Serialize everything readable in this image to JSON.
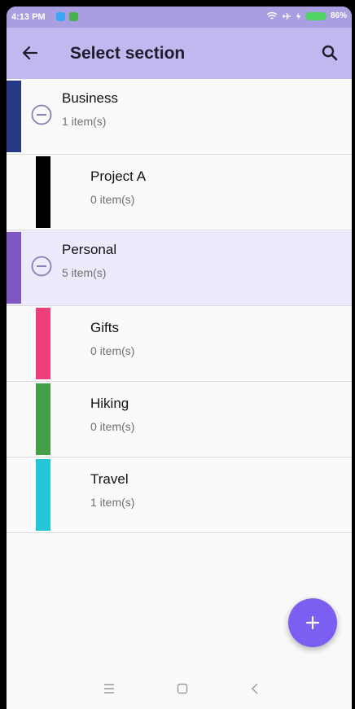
{
  "status_bar": {
    "time": "4:13 PM",
    "battery": "86%"
  },
  "app_bar": {
    "title": "Select section",
    "back_icon": "arrow-left-icon",
    "search_icon": "search-icon"
  },
  "sections": [
    {
      "name": "Business",
      "count": "1 item(s)",
      "level": "parent",
      "color": "#283a86",
      "expanded": true
    },
    {
      "name": "Project A",
      "count": "0 item(s)",
      "level": "child",
      "color": "#000000"
    },
    {
      "name": "Personal",
      "count": "5 item(s)",
      "level": "parent",
      "color": "#7e57c2",
      "expanded": true,
      "selected": true
    },
    {
      "name": "Gifts",
      "count": "0 item(s)",
      "level": "child",
      "color": "#ec407a"
    },
    {
      "name": "Hiking",
      "count": "0 item(s)",
      "level": "child",
      "color": "#43a047"
    },
    {
      "name": "Travel",
      "count": "1 item(s)",
      "level": "child",
      "color": "#26c6da"
    }
  ],
  "fab": {
    "icon": "plus-icon",
    "color": "#7c5ff0"
  },
  "colors": {
    "app_bar": "#c0b9f0",
    "status_bar": "#a99fe0",
    "selected_row": "#efe9fd"
  }
}
